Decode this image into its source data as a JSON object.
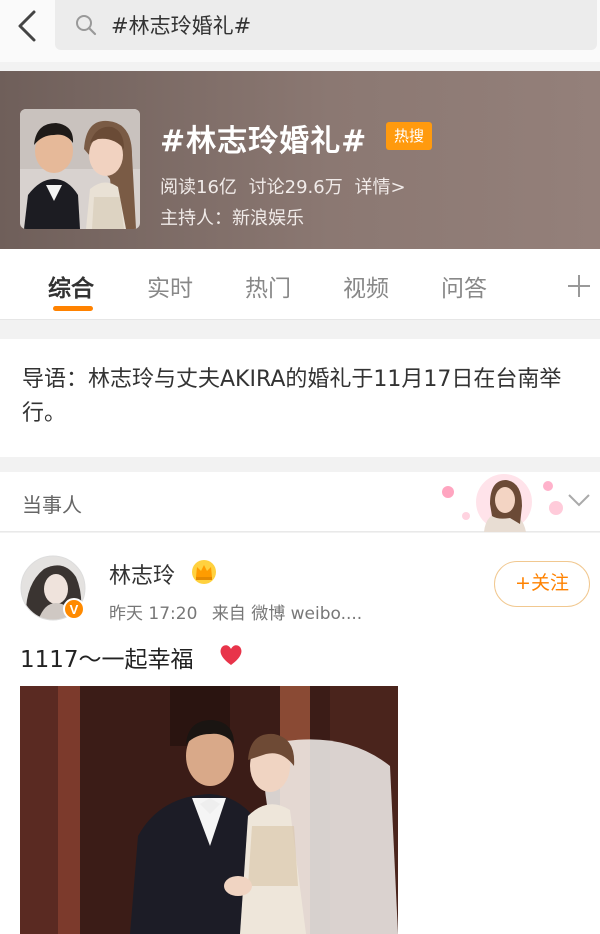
{
  "search": {
    "query": "#林志玲婚礼#"
  },
  "topic": {
    "title": "#林志玲婚礼#",
    "badge": "热搜",
    "reads": "阅读16亿",
    "discussions": "讨论29.6万",
    "details": "详情>",
    "host": "主持人：新浪娱乐"
  },
  "tabs": [
    {
      "label": "综合"
    },
    {
      "label": "实时"
    },
    {
      "label": "热门"
    },
    {
      "label": "视频"
    },
    {
      "label": "问答"
    }
  ],
  "intro": {
    "text": "导语：林志玲与丈夫AKIRA的婚礼于11月17日在台南举行。"
  },
  "section": {
    "label": "当事人"
  },
  "post": {
    "author": "林志玲",
    "time": "昨天 17:20",
    "source": "来自 微博 weibo....",
    "follow": "+关注",
    "text": "1117～一起幸福"
  },
  "colors": {
    "accent": "#ff8200",
    "hot_badge": "#ff9a0e",
    "header_bg": "#7f6d67"
  }
}
